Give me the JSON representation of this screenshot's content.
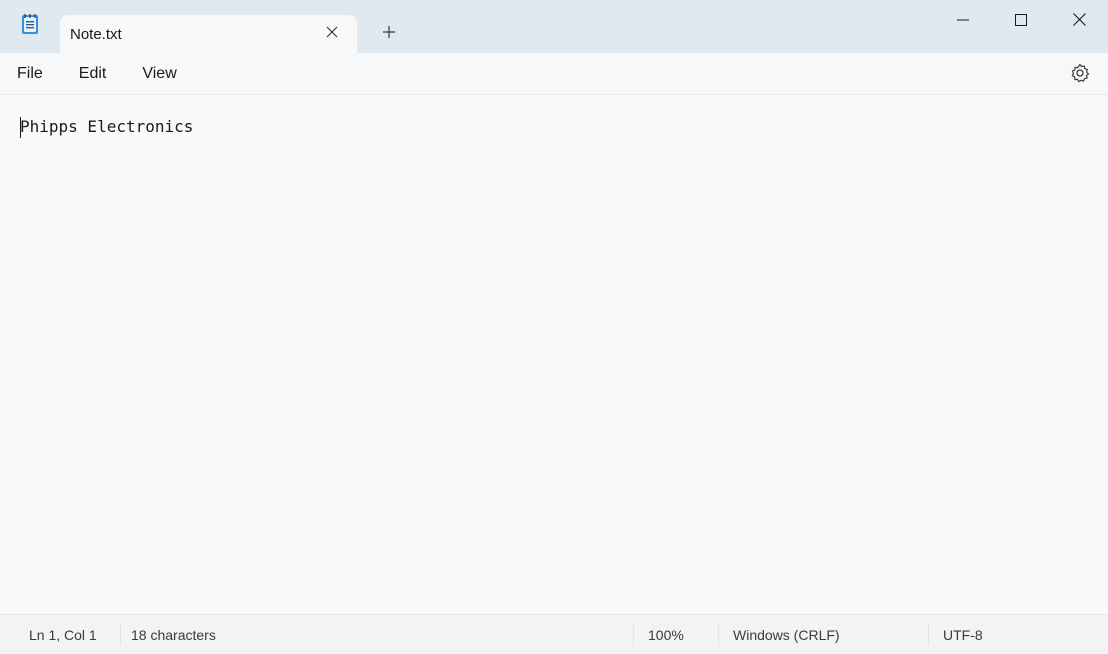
{
  "tab": {
    "title": "Note.txt"
  },
  "menu": {
    "file": "File",
    "edit": "Edit",
    "view": "View"
  },
  "editor": {
    "content": "Phipps Electronics"
  },
  "status": {
    "position": "Ln 1, Col 1",
    "characters": "18 characters",
    "zoom": "100%",
    "line_ending": "Windows (CRLF)",
    "encoding": "UTF-8"
  },
  "icons": {
    "app": "notepad-icon",
    "close_tab": "close-icon",
    "new_tab": "plus-icon",
    "minimize": "minimize-icon",
    "maximize": "maximize-icon",
    "close_window": "close-icon",
    "settings": "gear-icon"
  },
  "colors": {
    "titlebar": "#dfe9ef",
    "tab": "#f7f8f9",
    "editor_bg": "#f9f9f9",
    "icon_accent": "#3b8edb"
  }
}
